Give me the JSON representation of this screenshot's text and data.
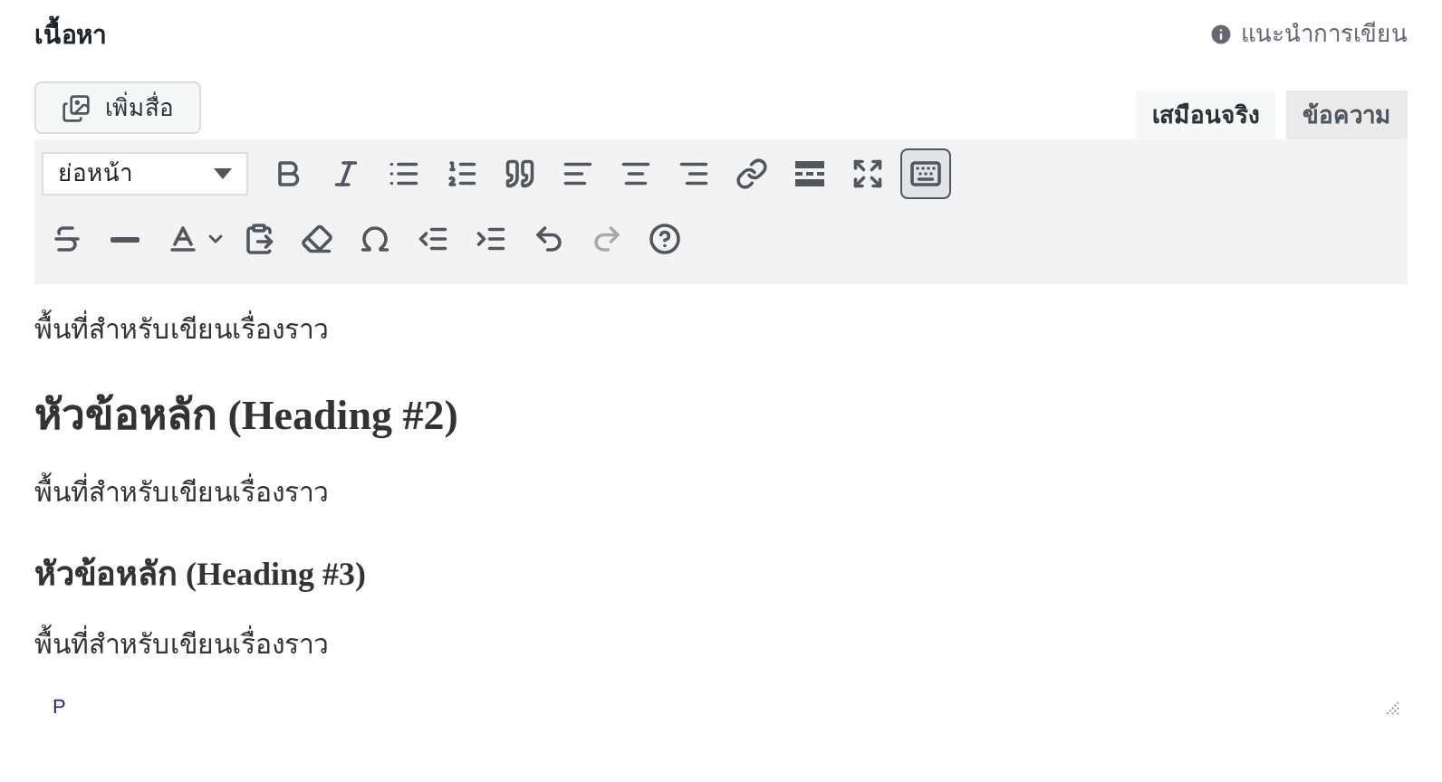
{
  "header": {
    "title": "เนื้อหา",
    "help_link": "แนะนำการเขียน"
  },
  "add_media": {
    "label": "เพิ่มสื่อ"
  },
  "tabs": [
    {
      "label": "เสมือนจริง",
      "selected": true
    },
    {
      "label": "ข้อความ",
      "selected": false
    }
  ],
  "format_select": {
    "value": "ย่อหน้า"
  },
  "toolbar_rows": [
    [
      {
        "kind": "bold",
        "pressed": false,
        "disabled": false
      },
      {
        "kind": "italic",
        "pressed": false,
        "disabled": false
      },
      {
        "kind": "bullets",
        "pressed": false,
        "disabled": false
      },
      {
        "kind": "numbers",
        "pressed": false,
        "disabled": false
      },
      {
        "kind": "quote",
        "pressed": false,
        "disabled": false
      },
      {
        "kind": "align-left",
        "pressed": false,
        "disabled": false
      },
      {
        "kind": "align-center",
        "pressed": false,
        "disabled": false
      },
      {
        "kind": "align-right",
        "pressed": false,
        "disabled": false
      },
      {
        "kind": "link",
        "pressed": false,
        "disabled": false
      },
      {
        "kind": "more",
        "pressed": false,
        "disabled": false
      },
      {
        "kind": "fullscreen",
        "pressed": false,
        "disabled": false
      },
      {
        "kind": "toolbar-toggle",
        "pressed": true,
        "disabled": false
      }
    ],
    [
      {
        "kind": "strike",
        "pressed": false,
        "disabled": false
      },
      {
        "kind": "hr",
        "pressed": false,
        "disabled": false
      },
      {
        "kind": "text-color",
        "pressed": false,
        "disabled": false
      },
      {
        "kind": "paste",
        "pressed": false,
        "disabled": false
      },
      {
        "kind": "clear",
        "pressed": false,
        "disabled": false
      },
      {
        "kind": "omega",
        "pressed": false,
        "disabled": false
      },
      {
        "kind": "outdent",
        "pressed": false,
        "disabled": false
      },
      {
        "kind": "indent",
        "pressed": false,
        "disabled": false
      },
      {
        "kind": "undo",
        "pressed": false,
        "disabled": false
      },
      {
        "kind": "redo",
        "pressed": false,
        "disabled": true
      },
      {
        "kind": "help",
        "pressed": false,
        "disabled": false
      }
    ]
  ],
  "content": [
    {
      "kind": "paragraph",
      "text": "พื้นที่สำหรับเขียนเรื่องราว"
    },
    {
      "kind": "h2",
      "text": "หัวข้อหลัก (Heading #2)"
    },
    {
      "kind": "paragraph",
      "text": "พื้นที่สำหรับเขียนเรื่องราว"
    },
    {
      "kind": "h3",
      "text": "หัวข้อหลัก (Heading #3)"
    },
    {
      "kind": "paragraph",
      "text": "พื้นที่สำหรับเขียนเรื่องราว"
    }
  ],
  "status_path": "P"
}
